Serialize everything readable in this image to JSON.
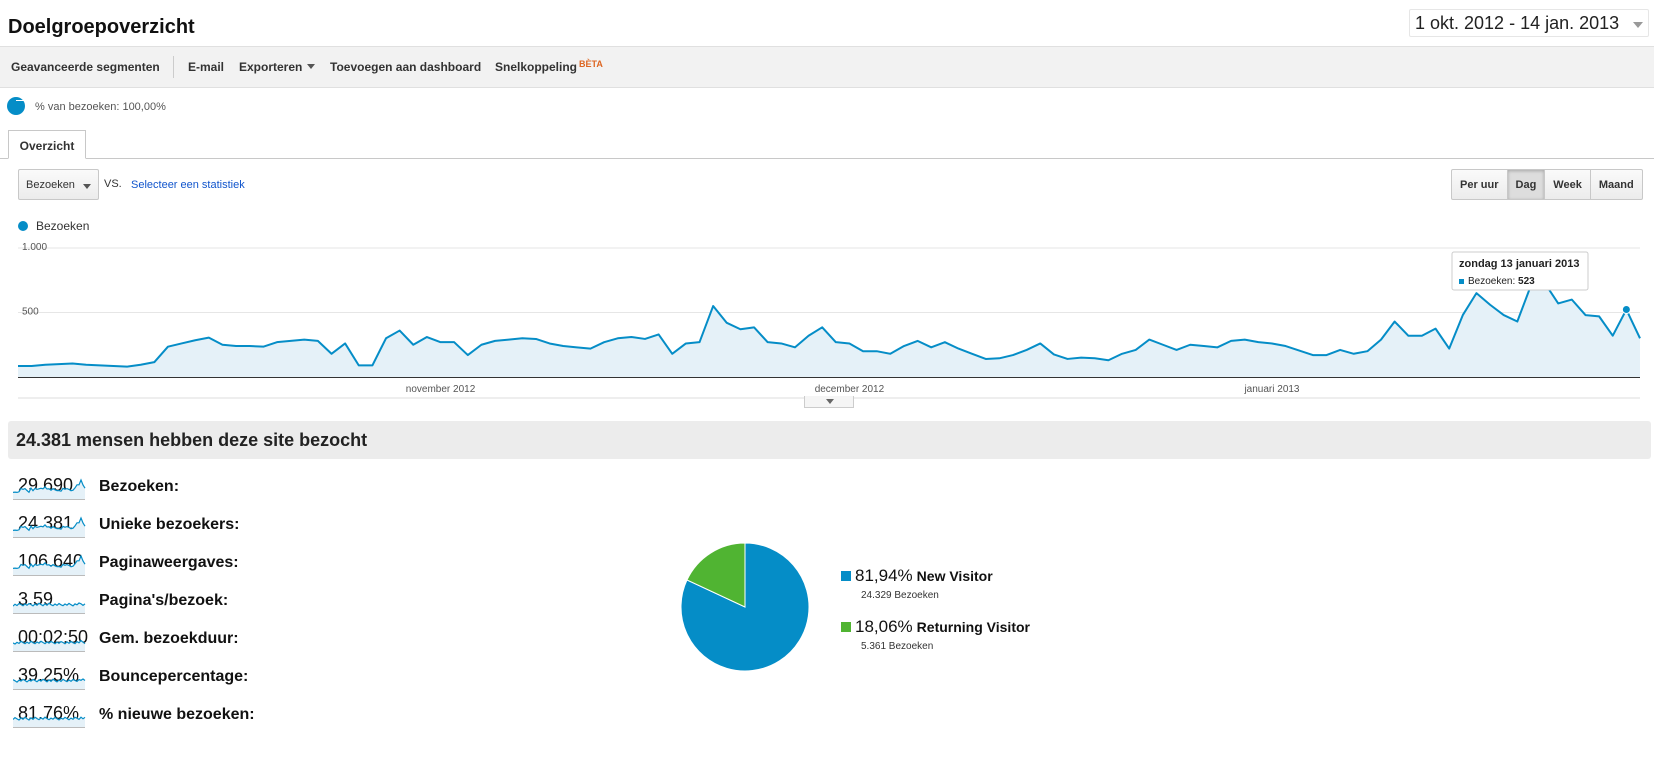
{
  "header": {
    "title": "Doelgroepoverzicht",
    "date_range": "1 okt. 2012 - 14 jan. 2013"
  },
  "toolbar": {
    "advanced_segments": "Geavanceerde segmenten",
    "email": "E-mail",
    "export": "Exporteren",
    "add_dashboard": "Toevoegen aan dashboard",
    "shortcut": "Snelkoppeling",
    "shortcut_badge": "BÈTA"
  },
  "segment": {
    "label": "% van bezoeken: 100,00%"
  },
  "tabs": [
    {
      "label": "Overzicht"
    }
  ],
  "chart_controls": {
    "metric": "Bezoeken",
    "vs": "VS.",
    "select_stat": "Selecteer een statistiek",
    "granularity": [
      "Per uur",
      "Dag",
      "Week",
      "Maand"
    ],
    "active_granularity": "Dag"
  },
  "colors": {
    "accent": "#058dc7",
    "returning": "#50b432",
    "area_fill": "#e5f1f8"
  },
  "chart_data": {
    "type": "area",
    "legend": "Bezoeken",
    "ylim": [
      0,
      1000
    ],
    "y_ticks": [
      "1.000",
      "500"
    ],
    "x_tick_labels": [
      "november 2012",
      "december 2012",
      "januari 2013"
    ],
    "x_tick_positions": [
      31,
      61,
      92
    ],
    "grid": true,
    "values": [
      85,
      85,
      95,
      100,
      105,
      95,
      90,
      85,
      80,
      95,
      115,
      235,
      260,
      285,
      305,
      250,
      240,
      240,
      235,
      270,
      280,
      290,
      280,
      180,
      260,
      90,
      90,
      300,
      360,
      250,
      310,
      270,
      270,
      170,
      250,
      280,
      290,
      300,
      295,
      260,
      240,
      230,
      220,
      270,
      300,
      310,
      295,
      330,
      180,
      260,
      270,
      550,
      420,
      370,
      385,
      270,
      260,
      230,
      320,
      385,
      270,
      260,
      200,
      200,
      180,
      240,
      280,
      230,
      270,
      220,
      180,
      140,
      145,
      170,
      210,
      260,
      175,
      140,
      150,
      145,
      130,
      180,
      210,
      290,
      250,
      210,
      250,
      240,
      230,
      280,
      290,
      270,
      260,
      240,
      205,
      170,
      170,
      210,
      180,
      200,
      290,
      430,
      320,
      320,
      375,
      220,
      480,
      650,
      560,
      480,
      430,
      710,
      730,
      570,
      600,
      480,
      470,
      320,
      523,
      300
    ],
    "tooltip": {
      "date": "zondag 13 januari 2013",
      "label": "Bezoeken",
      "value": "523"
    },
    "highlight_index": 118
  },
  "summary": {
    "title": "24.381 mensen hebben deze site bezocht"
  },
  "metrics": [
    {
      "label": "Bezoeken:",
      "value": "29.690"
    },
    {
      "label": "Unieke bezoekers:",
      "value": "24.381"
    },
    {
      "label": "Paginaweergaves:",
      "value": "106.640"
    },
    {
      "label": "Pagina's/bezoek:",
      "value": "3,59"
    },
    {
      "label": "Gem. bezoekduur:",
      "value": "00:02:50"
    },
    {
      "label": "Bouncepercentage:",
      "value": "39,25%"
    },
    {
      "label": "% nieuwe bezoeken:",
      "value": "81,76%"
    }
  ],
  "pie": {
    "type": "pie",
    "slices": [
      {
        "name": "New Visitor",
        "percent": 81.94,
        "percent_label": "81,94%",
        "sub": "24.329 Bezoeken",
        "color": "#058dc7"
      },
      {
        "name": "Returning Visitor",
        "percent": 18.06,
        "percent_label": "18,06%",
        "sub": "5.361 Bezoeken",
        "color": "#50b432"
      }
    ]
  }
}
